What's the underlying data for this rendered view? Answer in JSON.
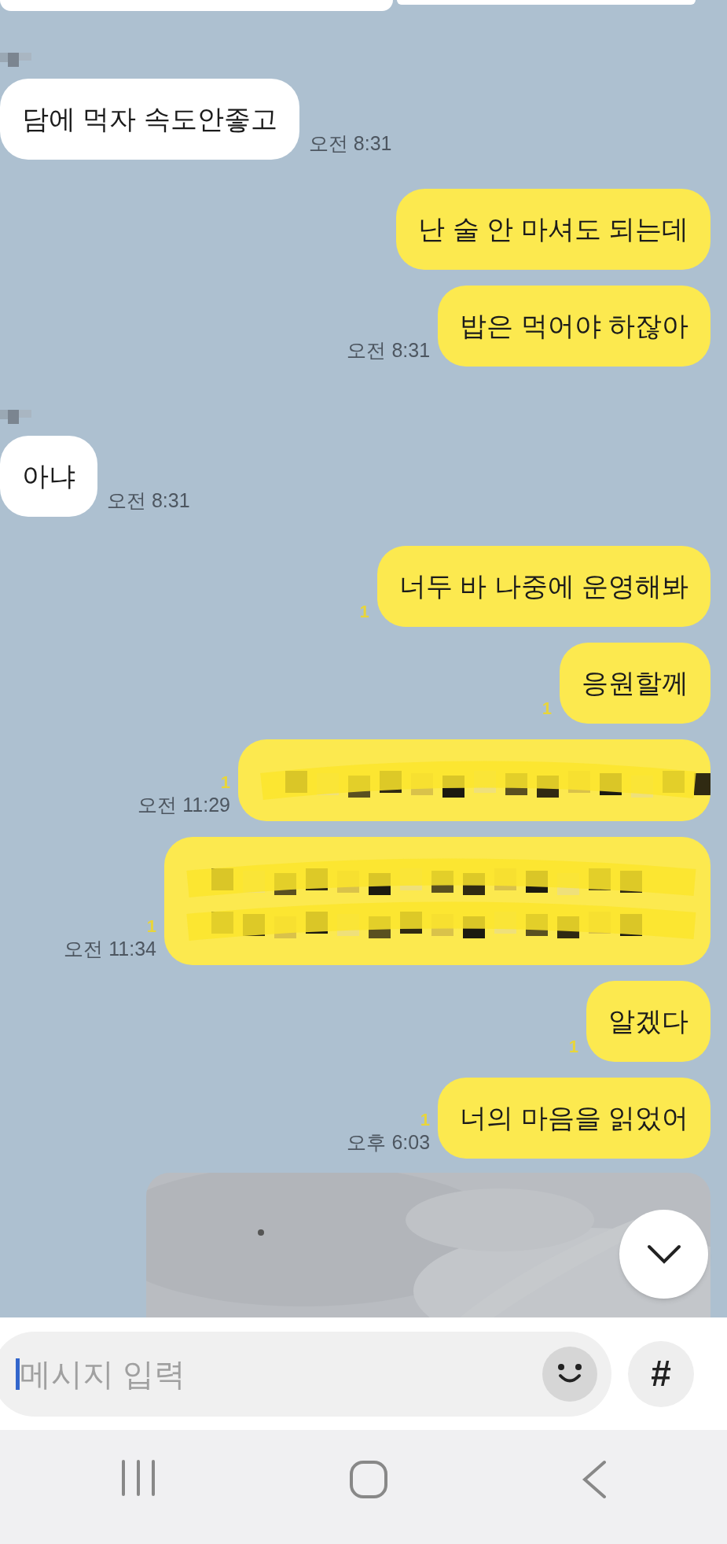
{
  "messages": [
    {
      "outgoing": false,
      "kind": "text",
      "text": "담에 먹자 속도안좋고",
      "time": "오전 8:31"
    },
    {
      "outgoing": true,
      "kind": "text",
      "text": "난 술 안 마셔도 되는데"
    },
    {
      "outgoing": true,
      "kind": "text",
      "text": "밥은 먹어야 하잖아",
      "time": "오전 8:31"
    },
    {
      "outgoing": false,
      "kind": "text",
      "text": "아냐",
      "time": "오전 8:31"
    },
    {
      "outgoing": true,
      "kind": "text",
      "text": "너두 바 나중에 운영해봐",
      "unread": "1"
    },
    {
      "outgoing": true,
      "kind": "text",
      "text": "응원할께",
      "unread": "1"
    },
    {
      "outgoing": true,
      "kind": "redacted_single",
      "unread": "1",
      "time": "오전 11:29"
    },
    {
      "outgoing": true,
      "kind": "redacted_double",
      "unread": "1",
      "time": "오전 11:34"
    },
    {
      "outgoing": true,
      "kind": "text",
      "text": "알겠다",
      "unread": "1"
    },
    {
      "outgoing": true,
      "kind": "text",
      "text": "너의 마음을 읽었어",
      "unread": "1",
      "time": "오후 6:03"
    },
    {
      "outgoing": true,
      "kind": "picture"
    }
  ],
  "input": {
    "placeholder": "메시지 입력"
  },
  "hash_button": "#"
}
